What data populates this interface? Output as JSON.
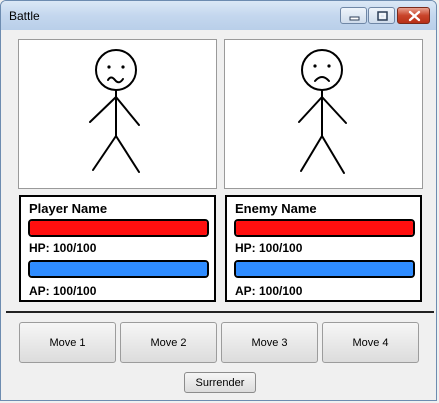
{
  "window": {
    "title": "Battle",
    "controls": [
      "minimize-icon",
      "maximize-icon",
      "close-icon"
    ]
  },
  "player": {
    "name": "Player Name",
    "hp_text": "HP: 100/100",
    "ap_text": "AP: 100/100",
    "hp_fraction": 1.0,
    "ap_fraction": 1.0,
    "expression": "confused"
  },
  "enemy": {
    "name": "Enemy Name",
    "hp_text": "HP: 100/100",
    "ap_text": "AP: 100/100",
    "hp_fraction": 1.0,
    "ap_fraction": 1.0,
    "expression": "sad"
  },
  "moves": [
    "Move 1",
    "Move 2",
    "Move 3",
    "Move 4"
  ],
  "surrender_label": "Surrender",
  "colors": {
    "hp": "#ff0f0f",
    "ap": "#2f8cff"
  }
}
